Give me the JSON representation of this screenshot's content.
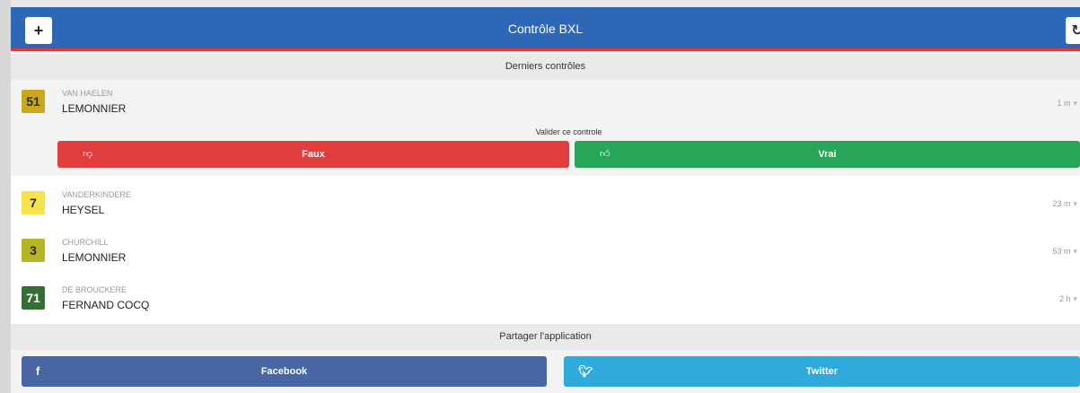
{
  "header": {
    "title": "Contrôle BXL",
    "add_icon": "+",
    "refresh_icon": "↻"
  },
  "recent": {
    "title": "Derniers contrôles",
    "items": [
      {
        "line": "51",
        "from": "VAN HAELEN",
        "to": "LEMONNIER",
        "time": "1 m",
        "badge_bg": "#c9a81e",
        "badge_fg": "#2a2a2a"
      },
      {
        "line": "7",
        "from": "VANDERKINDERE",
        "to": "HEYSEL",
        "time": "23 m",
        "badge_bg": "#f6e44a",
        "badge_fg": "#2a2a2a"
      },
      {
        "line": "3",
        "from": "CHURCHILL",
        "to": "LEMONNIER",
        "time": "53 m",
        "badge_bg": "#b6b526",
        "badge_fg": "#2a2a2a"
      },
      {
        "line": "71",
        "from": "DE BROUCKERE",
        "to": "FERNAND COCQ",
        "time": "2 h",
        "badge_bg": "#336e34",
        "badge_fg": "#ffffff"
      }
    ],
    "validate": {
      "label": "Valider ce controle",
      "false_label": "Faux",
      "true_label": "Vrai",
      "false_color": "#e03e3e",
      "true_color": "#27a65a"
    }
  },
  "share": {
    "title": "Partager l'application",
    "facebook_label": "Facebook",
    "twitter_label": "Twitter",
    "facebook_color": "#4865a4",
    "twitter_color": "#2eaadd"
  }
}
